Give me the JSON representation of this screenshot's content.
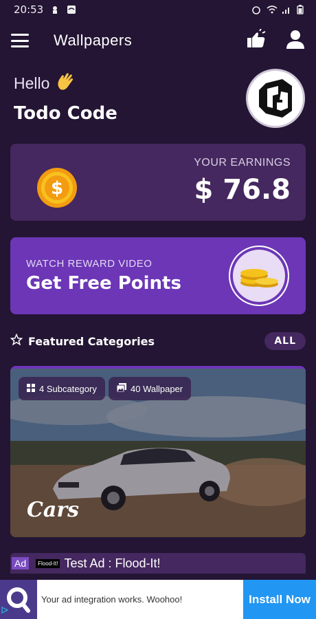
{
  "status_bar": {
    "time": "20:53"
  },
  "app_bar": {
    "title": "Wallpapers"
  },
  "greeting": {
    "hello": "Hello",
    "name": "Todo Code"
  },
  "earnings": {
    "label": "YOUR EARNINGS",
    "amount": "$ 76.8"
  },
  "reward": {
    "subtitle": "WATCH REWARD VIDEO",
    "title": "Get Free Points"
  },
  "featured": {
    "title": "Featured Categories",
    "all_label": "ALL",
    "card": {
      "subcategory_label": "4 Subcategory",
      "wallpaper_label": "40 Wallpaper",
      "name": "Cars"
    }
  },
  "ad": {
    "badge": "Ad",
    "logo_text": "Flood-It!",
    "title": "Test Ad : Flood-It!"
  },
  "banner": {
    "text": "Your ad integration works. Woohoo!",
    "button_label": "Install Now"
  },
  "colors": {
    "background": "#231533",
    "card": "#45285f",
    "accent": "#6c36b6",
    "install": "#2196f3"
  },
  "icons": [
    "menu-icon",
    "thumbs-up-icon",
    "profile-icon",
    "star-icon",
    "coin-icon",
    "gold-coins-icon",
    "grid-icon",
    "gallery-icon",
    "wave-hand-icon"
  ]
}
